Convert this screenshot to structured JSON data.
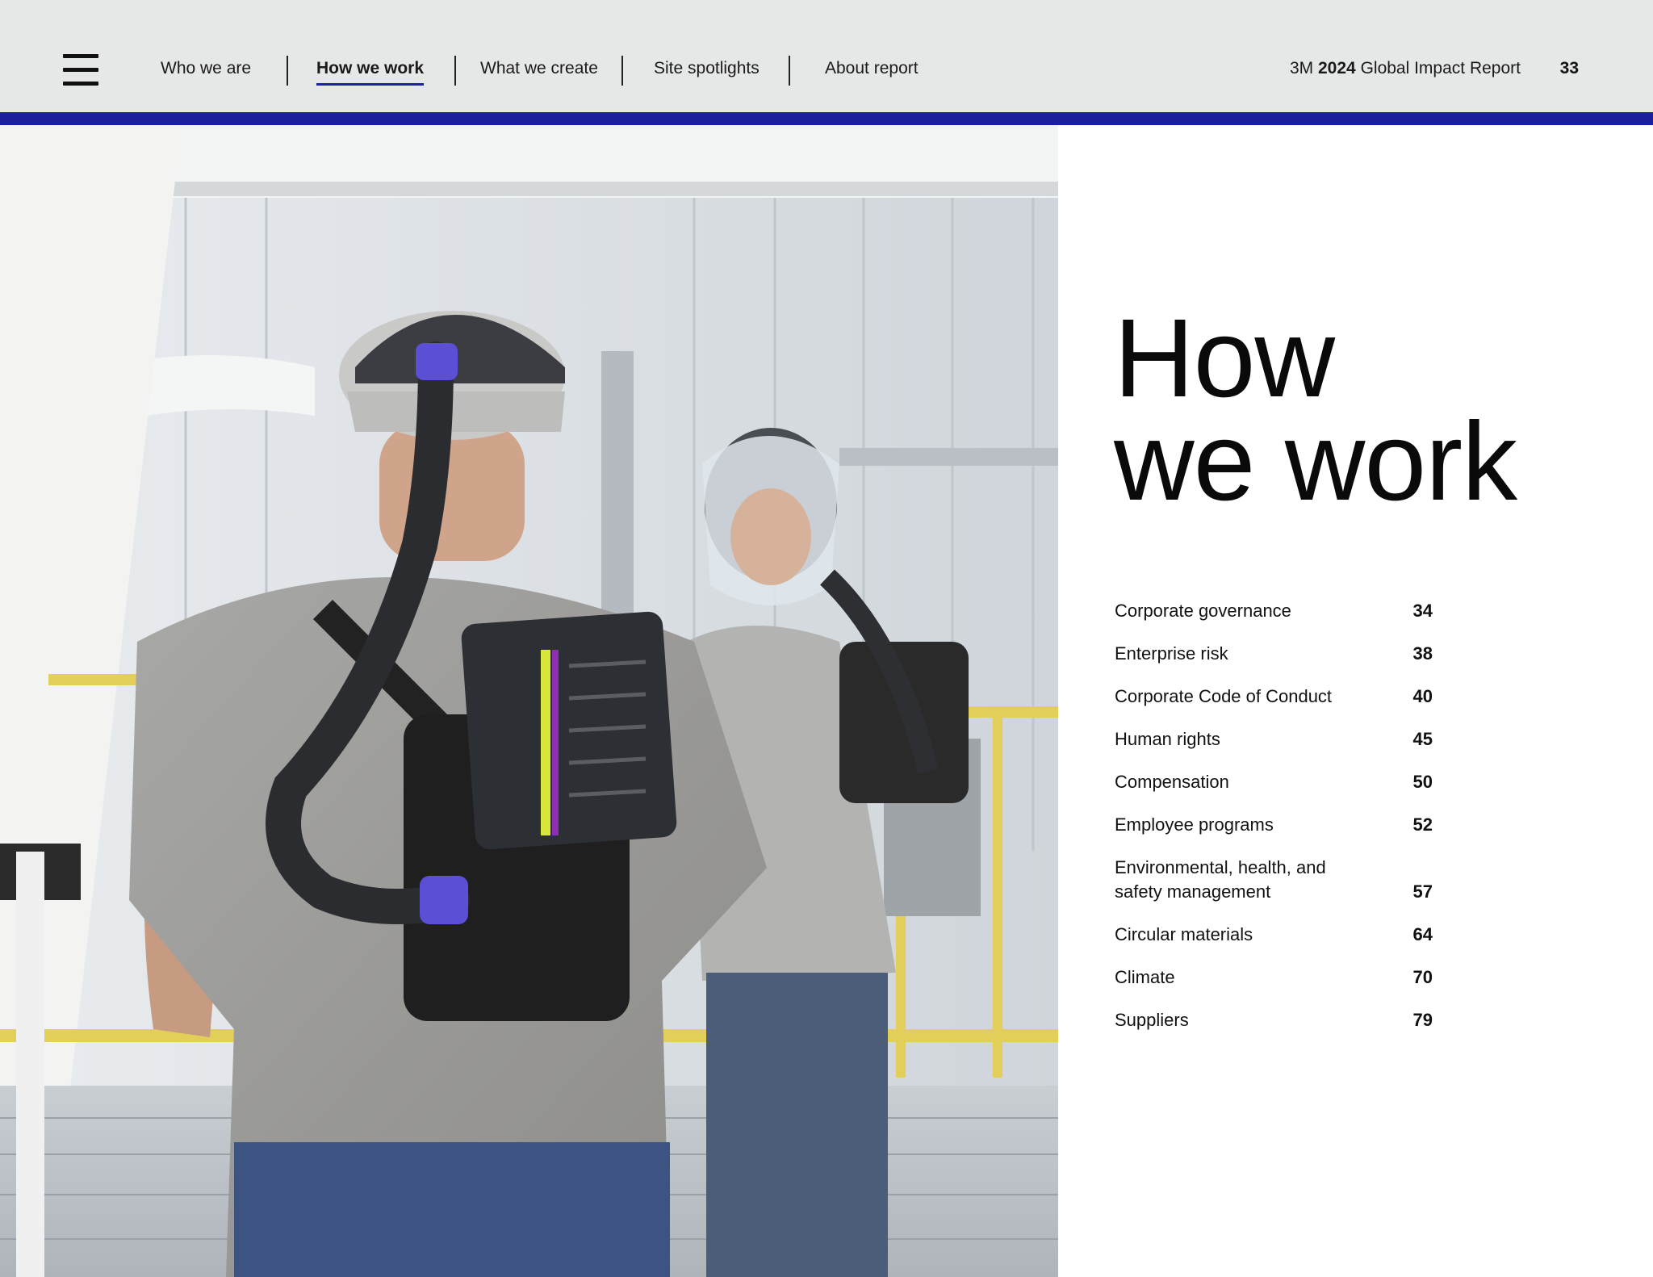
{
  "header": {
    "menu_icon": "hamburger-menu-icon",
    "nav": [
      {
        "label": "Who we are",
        "active": false
      },
      {
        "label": "How we work",
        "active": true
      },
      {
        "label": "What we create",
        "active": false
      },
      {
        "label": "Site spotlights",
        "active": false
      },
      {
        "label": "About report",
        "active": false
      }
    ],
    "report_prefix": "3M",
    "report_year": "2024",
    "report_suffix": "Global Impact Report",
    "page_number": "33",
    "accent_color": "#1a1f9c",
    "background_color": "#e6e8e7"
  },
  "section": {
    "title_line1": "How",
    "title_line2": "we work"
  },
  "toc": [
    {
      "label": "Corporate governance",
      "page": "34"
    },
    {
      "label": "Enterprise risk",
      "page": "38"
    },
    {
      "label": "Corporate Code of Conduct",
      "page": "40"
    },
    {
      "label": "Human rights",
      "page": "45"
    },
    {
      "label": "Compensation",
      "page": "50"
    },
    {
      "label": "Employee programs",
      "page": "52"
    },
    {
      "label": "Environmental, health, and safety management",
      "page": "57"
    },
    {
      "label": "Circular materials",
      "page": "64"
    },
    {
      "label": "Climate",
      "page": "70"
    },
    {
      "label": "Suppliers",
      "page": "79"
    }
  ],
  "photo": {
    "icon": "workers-photo"
  }
}
